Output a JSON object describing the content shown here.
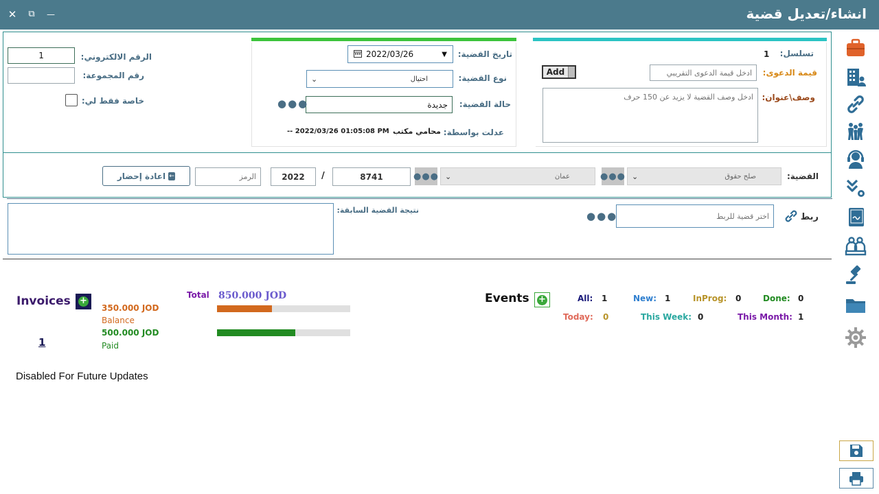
{
  "window": {
    "title": "انشاء/تعديل قضية",
    "close_glyph": "✕",
    "restore_glyph": "⧉",
    "minimize_glyph": "—"
  },
  "case_info": {
    "serial_label": "تسلسل:",
    "serial_value": "1",
    "claim_value_label": "قيمة الدعوى:",
    "claim_value_placeholder": "ادخل قيمة الدعوى التقريبي",
    "add_button": "Add",
    "description_label": "وصف\\عنوان:",
    "description_placeholder": "ادخل وصف القضية لا يزيد عن 150 حرف"
  },
  "case_details": {
    "date_label": "تاريخ القضية:",
    "date_value": "2022/03/26",
    "type_label": "نوع القضية:",
    "type_value": "احتيال",
    "status_label": "حالة القضية:",
    "status_value": "جديدة",
    "modified_by_label": "عدلت بواسطة:",
    "modified_by_value": "محامي مكتب",
    "modified_at": "-- 2022/03/26 01:05:08 PM"
  },
  "electronic": {
    "number_label": "الرقم الالكتروني:",
    "number_value": "1",
    "group_label": "رقم المجموعة:",
    "private_label": "خاصة فقط لي:"
  },
  "case_row": {
    "label": "القضية:",
    "court_value": "صلح حقوق",
    "city_value": "عمان",
    "number_value": "8741",
    "separator": "/",
    "year_value": "2022",
    "code_placeholder": "الرمز",
    "resummon_button": "اعادة إحضار"
  },
  "link": {
    "label": "ربط",
    "placeholder": "اختر قضية للربط",
    "previous_result_label": "نتيجة القضية السابقة:"
  },
  "invoices": {
    "title": "Invoices",
    "count": "1",
    "total_label": "Total",
    "total_value": "850.000 JOD",
    "balance_value": "350.000 JOD",
    "balance_label": "Balance",
    "balance_fraction": 0.4118,
    "paid_value": "500.000 JOD",
    "paid_label": "Paid",
    "paid_fraction": 0.5882,
    "disabled_note": "Disabled For Future Updates"
  },
  "events": {
    "title": "Events",
    "all_label": "All:",
    "all_value": "1",
    "new_label": "New:",
    "new_value": "1",
    "inprog_label": "InProg:",
    "inprog_value": "0",
    "done_label": "Done:",
    "done_value": "0",
    "today_label": "Today:",
    "today_value": "0",
    "week_label": "This Week:",
    "week_value": "0",
    "month_label": "This Month:",
    "month_value": "1"
  },
  "colors": {
    "titlebar": "#4b7a8c",
    "sidebar_icon": "#2f6d96",
    "briefcase": "#e0622a",
    "balance": "#d2691e",
    "paid": "#228b22",
    "total": "#6a5acd"
  },
  "sidebar_icons": [
    "briefcase-icon",
    "building-icon",
    "link-icon",
    "people-icon",
    "support-icon",
    "tasks-icon",
    "notebook-icon",
    "court-icon",
    "gavel-icon",
    "folder-icon",
    "gear-icon"
  ]
}
